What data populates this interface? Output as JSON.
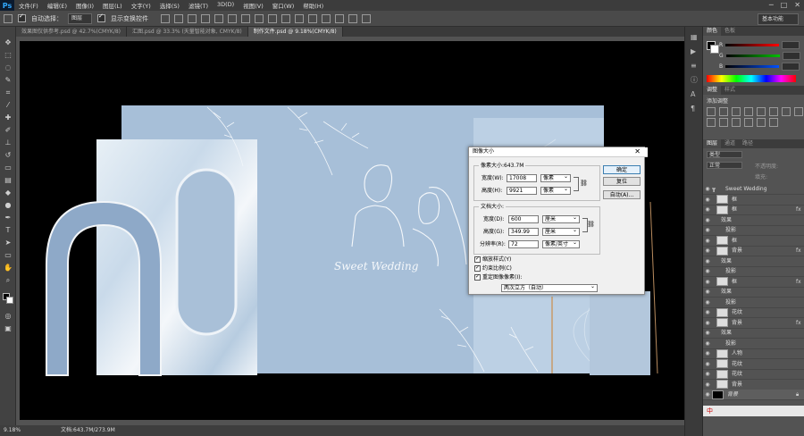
{
  "app": {
    "logo": "Ps"
  },
  "menu": [
    "文件(F)",
    "编辑(E)",
    "图像(I)",
    "图层(L)",
    "文字(Y)",
    "选择(S)",
    "滤镜(T)",
    "3D(D)",
    "视图(V)",
    "窗口(W)",
    "帮助(H)"
  ],
  "window_controls": {
    "minimize": "─",
    "maximize": "□",
    "close": "✕"
  },
  "options": {
    "auto_select_label": "自动选择：",
    "auto_select_value": "图层",
    "show_transform_label": "显示变换控件",
    "workspace": "基本功能"
  },
  "tabs": [
    {
      "label": "效果图仅供参考.psd @ 42.7%(CMYK/8)",
      "active": false
    },
    {
      "label": "汇图.psd @ 33.3% (天量智能对象, CMYK/8)",
      "active": false
    },
    {
      "label": "制作文件.psd @ 9.18%(CMYK/8)",
      "active": true
    }
  ],
  "status": {
    "zoom": "9.18%",
    "doc": "文档:643.7M/273.9M"
  },
  "artwork": {
    "title": "Sweet  Wedding"
  },
  "panels": {
    "color_tabs": [
      "颜色",
      "色板"
    ],
    "color_channels": [
      "R",
      "G",
      "B"
    ],
    "adjust_tabs": [
      "调整",
      "样式"
    ],
    "adjust_label": "添加调整",
    "layer_tabs": [
      "图层",
      "通道",
      "路径"
    ],
    "layer_kind": "类型",
    "blend_mode": "正常",
    "opacity_label": "不透明度:",
    "fill_label": "填充:",
    "layers": [
      {
        "name": "Sweet  Wedding",
        "type": "text",
        "indent": 0,
        "fx": false
      },
      {
        "name": "框",
        "type": "layer",
        "indent": 1,
        "fx": false
      },
      {
        "name": "框",
        "type": "layer",
        "indent": 1,
        "fx": true
      },
      {
        "name": "效果",
        "type": "effect",
        "indent": 2,
        "fx": false
      },
      {
        "name": "投影",
        "type": "effect",
        "indent": 3,
        "fx": false
      },
      {
        "name": "框",
        "type": "layer",
        "indent": 1,
        "fx": false
      },
      {
        "name": "背景",
        "type": "layer",
        "indent": 1,
        "fx": true
      },
      {
        "name": "效果",
        "type": "effect",
        "indent": 2,
        "fx": false
      },
      {
        "name": "投影",
        "type": "effect",
        "indent": 3,
        "fx": false
      },
      {
        "name": "框",
        "type": "layer",
        "indent": 1,
        "fx": true
      },
      {
        "name": "效果",
        "type": "effect",
        "indent": 2,
        "fx": false
      },
      {
        "name": "投影",
        "type": "effect",
        "indent": 3,
        "fx": false
      },
      {
        "name": "花纹",
        "type": "layer",
        "indent": 1,
        "fx": false
      },
      {
        "name": "背景",
        "type": "layer",
        "indent": 1,
        "fx": true
      },
      {
        "name": "效果",
        "type": "effect",
        "indent": 2,
        "fx": false
      },
      {
        "name": "投影",
        "type": "effect",
        "indent": 3,
        "fx": false
      },
      {
        "name": "人物",
        "type": "layer",
        "indent": 1,
        "fx": false
      },
      {
        "name": "花纹",
        "type": "layer",
        "indent": 1,
        "fx": false
      },
      {
        "name": "花纹",
        "type": "layer",
        "indent": 1,
        "fx": false
      },
      {
        "name": "背景",
        "type": "layer",
        "indent": 1,
        "fx": false
      },
      {
        "name": "背景",
        "type": "background",
        "indent": 0,
        "fx": false
      }
    ],
    "ime_text": "中"
  },
  "dialog": {
    "title": "图像大小",
    "close": "✕",
    "pixel_group": "像素大小:643.7M",
    "width_label": "宽度(W):",
    "width_value": "17008",
    "width_unit": "像素",
    "height_label": "高度(H):",
    "height_value": "9921",
    "height_unit": "像素",
    "doc_group": "文档大小:",
    "doc_width_label": "宽度(D):",
    "doc_width_value": "600",
    "doc_width_unit": "厘米",
    "doc_height_label": "高度(G):",
    "doc_height_value": "349.99",
    "doc_height_unit": "厘米",
    "res_label": "分辨率(R):",
    "res_value": "72",
    "res_unit": "像素/英寸",
    "scale_styles": "缩放样式(Y)",
    "constrain": "约束比例(C)",
    "resample": "重定图像像素(I):",
    "resample_method": "两次立方（自动）",
    "ok": "确定",
    "reset": "复位",
    "auto": "自动(A)..."
  }
}
